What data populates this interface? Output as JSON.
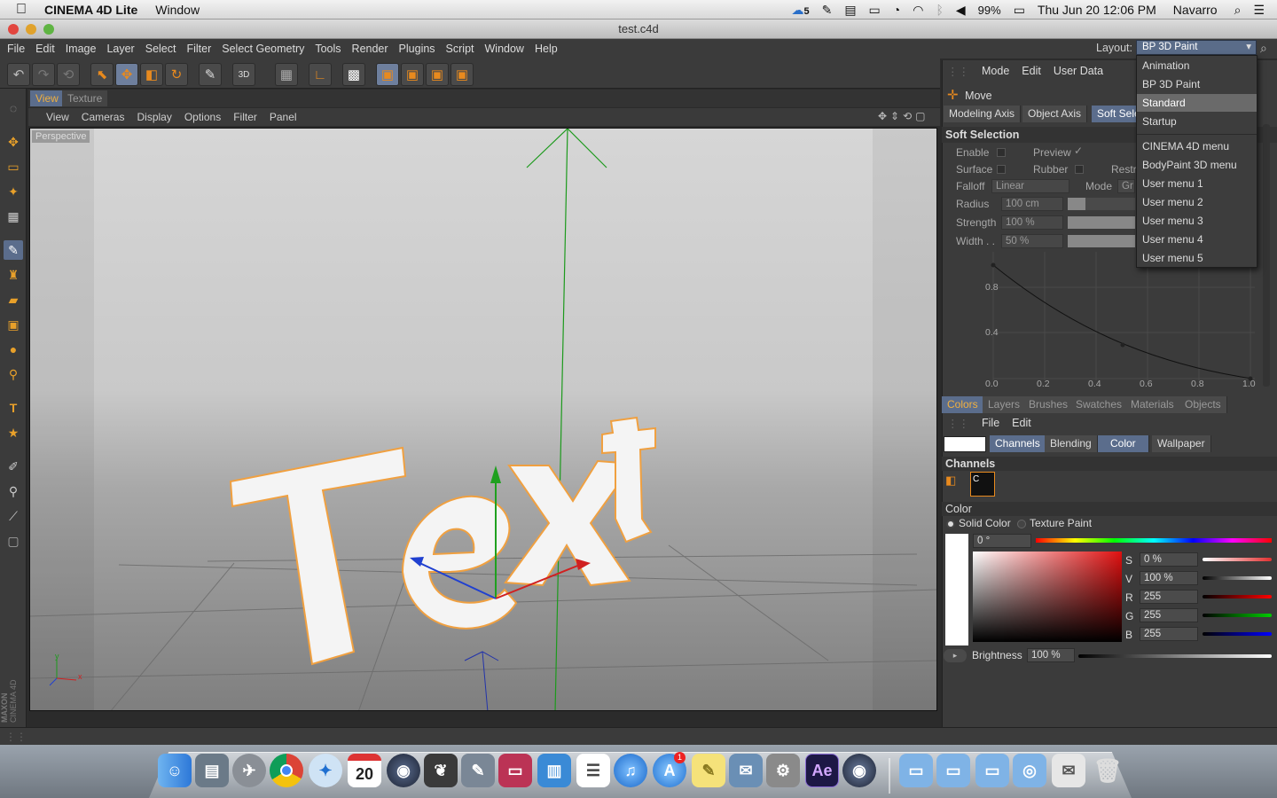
{
  "macos_menubar": {
    "app_name": "CINEMA 4D Lite",
    "menus": [
      "Window"
    ],
    "status_items": {
      "cc_badge": "5",
      "battery": "99%",
      "datetime": "Thu Jun 20  12:06 PM",
      "user": "Navarro"
    }
  },
  "window": {
    "title": "test.c4d"
  },
  "app_menu": [
    "File",
    "Edit",
    "Image",
    "Layer",
    "Select",
    "Filter",
    "Select Geometry",
    "Tools",
    "Render",
    "Plugins",
    "Script",
    "Window",
    "Help"
  ],
  "layout": {
    "label": "Layout:",
    "selected": "BP 3D Paint"
  },
  "layout_dropdown": {
    "items": [
      "Animation",
      "BP 3D Paint",
      "Standard",
      "Startup",
      "CINEMA 4D menu",
      "BodyPaint 3D menu",
      "User menu 1",
      "User menu 2",
      "User menu 3",
      "User menu 4",
      "User menu 5"
    ],
    "highlighted": "Standard"
  },
  "toolbar": {
    "mode3d_label": "3D"
  },
  "view_tabs": [
    "View",
    "Texture"
  ],
  "view_menu": [
    "View",
    "Cameras",
    "Display",
    "Options",
    "Filter",
    "Panel"
  ],
  "viewport": {
    "camera_label": "Perspective",
    "scene_text": "Text",
    "axis_x": "x",
    "axis_y": "y",
    "watermark_brand": "MAXON",
    "watermark_product": "CINEMA 4D"
  },
  "attributes": {
    "menu": [
      "Mode",
      "Edit",
      "User Data"
    ],
    "tool_name": "Move",
    "tabs": [
      "Modeling Axis",
      "Object Axis",
      "Soft Sele"
    ],
    "section_title": "Soft Selection",
    "enable_label": "Enable",
    "preview_label": "Preview",
    "preview_check": "✓",
    "surface_label": "Surface",
    "rubber_label": "Rubber",
    "restrict_label": "Restr",
    "falloff_label": "Falloff",
    "falloff_value": "Linear",
    "mode_label": "Mode",
    "mode_value": "Gr",
    "radius_label": "Radius",
    "radius_value": "100 cm",
    "strength_label": "Strength",
    "strength_value": "100 %",
    "width_label": "Width . .",
    "width_value": "50 %",
    "graph_y_labels": [
      "0.8",
      "0.4"
    ],
    "graph_x_labels": [
      "0.0",
      "0.2",
      "0.4",
      "0.6",
      "0.8",
      "1.0"
    ]
  },
  "colors_panel": {
    "tabs": [
      "Colors",
      "Layers",
      "Brushes",
      "Swatches",
      "Materials",
      "Objects"
    ],
    "menu": [
      "File",
      "Edit"
    ],
    "subtabs": [
      "Channels",
      "Blending",
      "Color",
      "Wallpaper"
    ],
    "channels_title": "Channels",
    "channel_item": "C",
    "color_title": "Color",
    "solid_color_label": "Solid Color",
    "texture_paint_label": "Texture Paint",
    "hue_value": "0 °",
    "s_label": "S",
    "s_value": "0 %",
    "v_label": "V",
    "v_value": "100 %",
    "r_label": "R",
    "r_value": "255",
    "g_label": "G",
    "g_value": "255",
    "b_label": "B",
    "b_value": "255",
    "brightness_label": "Brightness",
    "brightness_value": "100 %"
  },
  "dock": {
    "calendar_day": "20",
    "ae_label": "Ae",
    "appstore_badge": "1"
  },
  "colors": {
    "accent_blue": "#5b6d8c",
    "orange": "#e88a1e",
    "selection_outline": "#f0a040"
  }
}
